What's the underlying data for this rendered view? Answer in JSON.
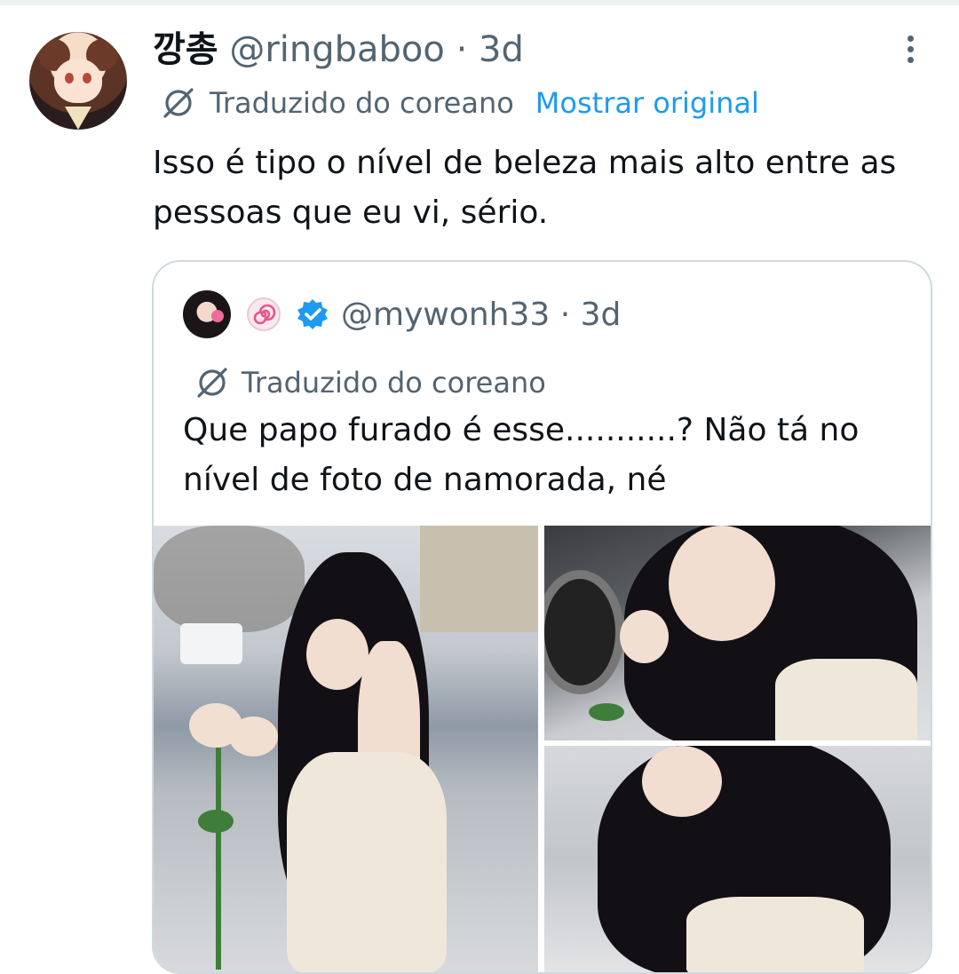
{
  "tweet": {
    "author_name": "깡총",
    "author_handle": "@ringbaboo",
    "separator": "·",
    "time": "3d",
    "translated_label": "Traduzido do coreano",
    "show_original_label": "Mostrar original",
    "text": "Isso é tipo o nível de beleza mais alto entre as pessoas que eu vi, sério."
  },
  "quote": {
    "author_handle": "@mywonh33",
    "separator": "·",
    "time": "3d",
    "translated_label": "Traduzido do coreano",
    "text": "Que papo furado é esse...........? Não tá no nível de foto de namorada, né"
  },
  "icons": {
    "more": "more-vertical-icon",
    "translate": "translate-icon",
    "spiral": "spiral-badge-icon",
    "verified": "verified-badge-icon"
  },
  "colors": {
    "link": "#1d9bf0",
    "secondary_text": "#536471",
    "border": "#cfd9de",
    "verified": "#1d9bf0"
  }
}
